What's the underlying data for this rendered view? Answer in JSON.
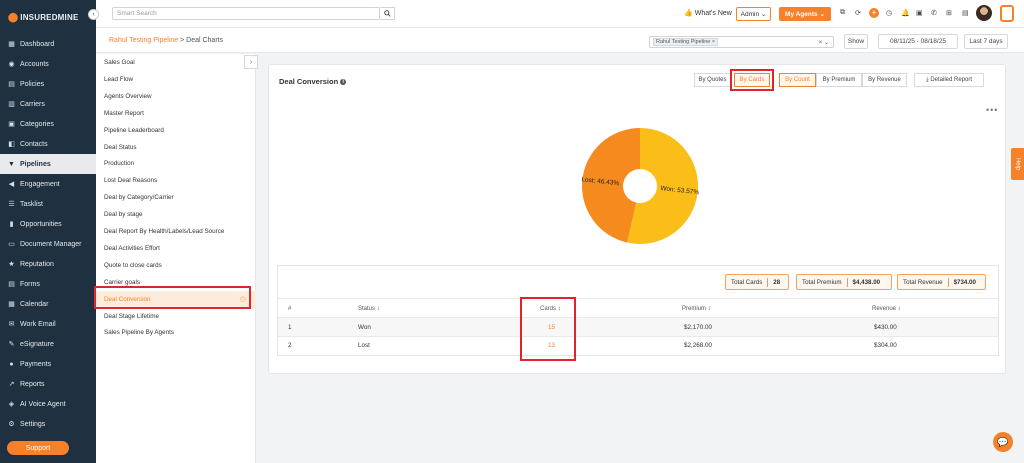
{
  "brand": {
    "name": "INSUREDMINE",
    "accent": "#f5822a",
    "sidebar_bg": "#1f3040"
  },
  "sidebar": {
    "items": [
      {
        "label": "Dashboard",
        "icon": "grid-icon"
      },
      {
        "label": "Accounts",
        "icon": "user-icon"
      },
      {
        "label": "Policies",
        "icon": "document-icon"
      },
      {
        "label": "Carriers",
        "icon": "building-icon"
      },
      {
        "label": "Categories",
        "icon": "folder-icon"
      },
      {
        "label": "Contacts",
        "icon": "contact-icon"
      },
      {
        "label": "Pipelines",
        "icon": "filter-icon",
        "active": true
      },
      {
        "label": "Engagement",
        "icon": "megaphone-icon"
      },
      {
        "label": "Tasklist",
        "icon": "list-icon"
      },
      {
        "label": "Opportunities",
        "icon": "chart-icon"
      },
      {
        "label": "Document Manager",
        "icon": "folder-open-icon"
      },
      {
        "label": "Reputation",
        "icon": "star-icon"
      },
      {
        "label": "Forms",
        "icon": "form-icon"
      },
      {
        "label": "Calendar",
        "icon": "calendar-icon"
      },
      {
        "label": "Work Email",
        "icon": "mail-icon"
      },
      {
        "label": "eSignature",
        "icon": "pen-icon"
      },
      {
        "label": "Payments",
        "icon": "dollar-icon"
      },
      {
        "label": "Reports",
        "icon": "report-icon"
      },
      {
        "label": "AI Voice Agent",
        "icon": "robot-icon"
      },
      {
        "label": "Settings",
        "icon": "gear-icon"
      }
    ],
    "support_label": "Support"
  },
  "topbar": {
    "search_placeholder": "Smart Search",
    "whats_new": "What's New",
    "admin": "Admin",
    "my_agents": "My Agents"
  },
  "breadcrumb": {
    "pipeline": "Rahul Testing Pipeline",
    "separator": ">",
    "page": "Deal Charts"
  },
  "filters": {
    "pipeline_tag": "Rahul Testing Pipeline",
    "show_label": "Show",
    "date_range": "08/11/25 - 08/18/25",
    "preset": "Last 7 days"
  },
  "reports": {
    "items": [
      "Sales Goal",
      "Lead Flow",
      "Agents Overview",
      "Master Report",
      "Pipeline Leaderboard",
      "Deal Status",
      "Production",
      "Lost Deal Reasons",
      "Deal by Category/Carrier",
      "Deal by stage",
      "Deal Report By Health/Labels/Lead Source",
      "Deal Activities Effort",
      "Quote to close cards",
      "Carrier goals",
      "Deal Conversion",
      "Deal Stage Lifetime",
      "Sales Pipeline By Agents"
    ],
    "active_index": 14
  },
  "card": {
    "title": "Deal Conversion",
    "tabs": [
      "By Quotes",
      "By Cards",
      "By Count",
      "By Premium",
      "By Revenue"
    ],
    "detailed_report": "Detailed Report"
  },
  "chart_data": {
    "type": "pie",
    "donut": true,
    "slices": [
      {
        "label": "Won",
        "value": 53.57,
        "display": "Won: 53.57%",
        "color": "#fbbd18"
      },
      {
        "label": "Lost",
        "value": 46.43,
        "display": "Lost: 46.43%",
        "color": "#f58a1f"
      }
    ]
  },
  "summary": {
    "total_cards_label": "Total Cards",
    "total_cards": "28",
    "total_premium_label": "Total Premium",
    "total_premium": "$4,438.00",
    "total_revenue_label": "Total Revenue",
    "total_revenue": "$734.00"
  },
  "table": {
    "headers": [
      "#",
      "Status ↕",
      "Cards ↕",
      "Premium ↕",
      "Revenue ↕"
    ],
    "rows": [
      [
        "1",
        "Won",
        "15",
        "$2,170.00",
        "$430.00"
      ],
      [
        "2",
        "Lost",
        "13",
        "$2,268.00",
        "$304.00"
      ]
    ]
  },
  "help_label": "Help"
}
